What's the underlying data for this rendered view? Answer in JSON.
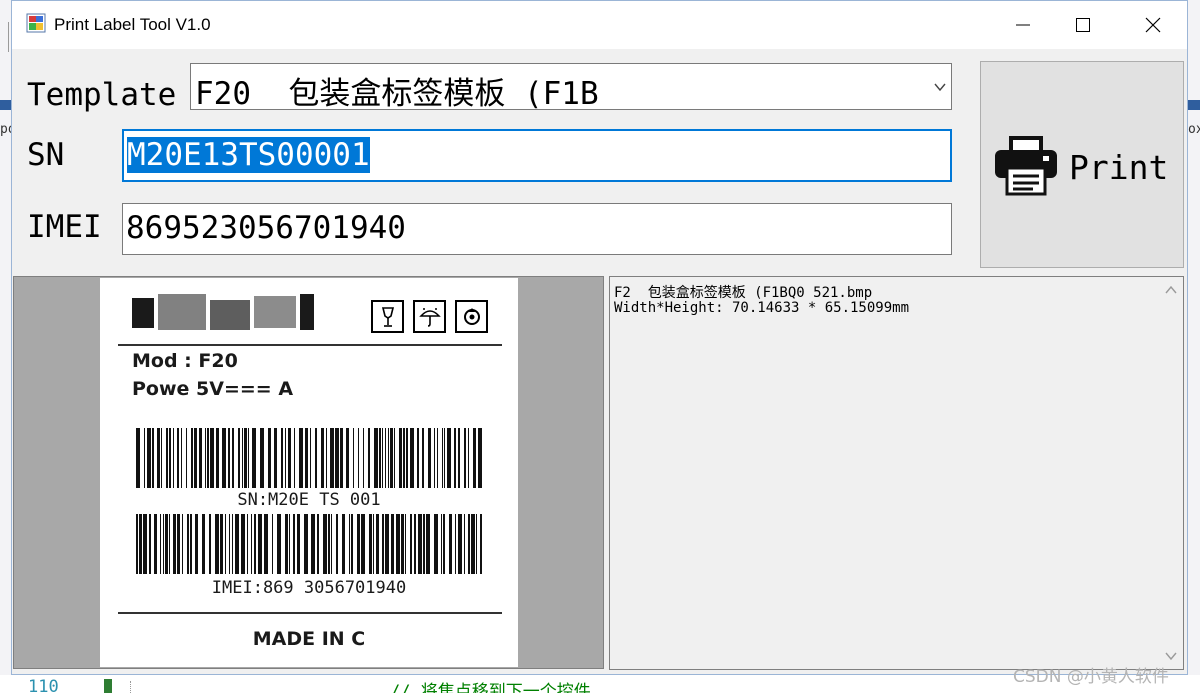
{
  "window": {
    "title": "Print Label Tool V1.0"
  },
  "form": {
    "template_label": "Template",
    "template_value": "F20_ 包装盒标签模板 (F1B",
    "sn_label": "SN",
    "sn_value": "M20E13TS00001",
    "imei_label": "IMEI",
    "imei_value": "869523056701940"
  },
  "print_button": {
    "label": "Print",
    "icon": "printer-icon"
  },
  "preview": {
    "brand_name": "",
    "model_line": "Mod : F20",
    "power_line": "Powe 5V=== A",
    "barcode1_text": "SN:M20E  TS   001",
    "barcode2_text": "IMEI:869 3056701940",
    "made_in": "MADE IN C",
    "package_icons": [
      "fragile-icon",
      "keep-dry-icon",
      "recycle-icon"
    ]
  },
  "info": {
    "line1": "F2  包装盒标签模板 (F1BQ0 521.bmp",
    "line2": "Width*Height: 70.14633 * 65.15099mm"
  },
  "background": {
    "line_number": "110",
    "comment": "// 将焦点移到下一个控件",
    "left_fragment": "po",
    "right_fragment": "ox"
  },
  "watermark": "CSDN @小黄人软件",
  "colors": {
    "selection": "#0078d7",
    "window_bg": "#f0f0f0",
    "preview_bg": "#a8a8a8"
  }
}
